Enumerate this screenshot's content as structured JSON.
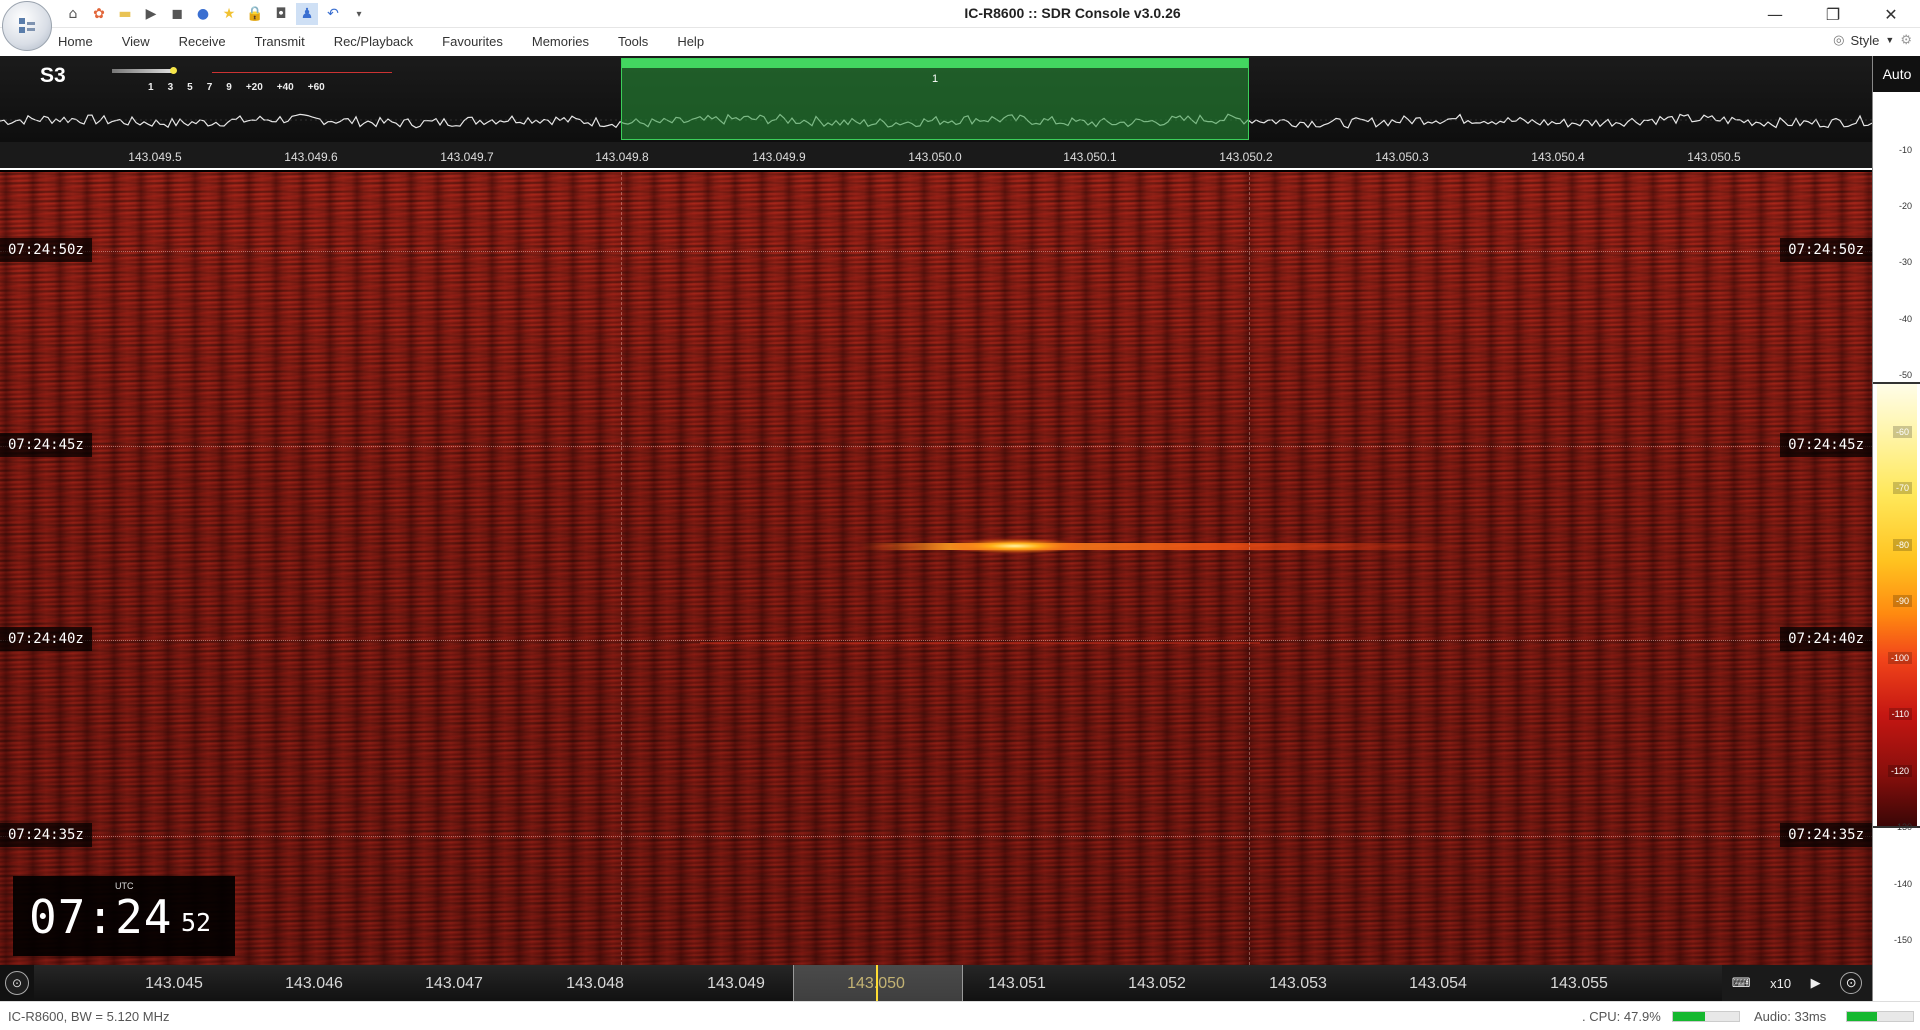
{
  "window": {
    "title": "IC-R8600 :: SDR Console v3.0.26"
  },
  "quick_access": [
    "home-icon",
    "radio-icon",
    "folder-icon",
    "play-icon",
    "stop-icon",
    "record-icon",
    "star-icon",
    "lock-icon",
    "camera-icon",
    "person-icon",
    "undo-icon",
    "dropdown-icon"
  ],
  "menu": [
    "Home",
    "View",
    "Receive",
    "Transmit",
    "Rec/Playback",
    "Favourites",
    "Memories",
    "Tools",
    "Help"
  ],
  "style_menu": {
    "label": "Style"
  },
  "spectrum": {
    "smeter": "S3",
    "smeter_scale": [
      "1",
      "3",
      "5",
      "7",
      "9",
      "+20",
      "+40",
      "+60"
    ],
    "filter_number": "1",
    "auto_label": "Auto"
  },
  "top_freq_axis": [
    "143.049.5",
    "143.049.6",
    "143.049.7",
    "143.049.8",
    "143.049.9",
    "143.050.0",
    "143.050.1",
    "143.050.2",
    "143.050.3",
    "143.050.4",
    "143.050.5"
  ],
  "waterfall": {
    "time_labels": [
      "07:24:50z",
      "07:24:45z",
      "07:24:40z",
      "07:24:35z"
    ]
  },
  "clock": {
    "utc_label": "UTC",
    "hours_minutes": "07:24",
    "seconds": "52"
  },
  "db_scale": {
    "auto_label": "Auto",
    "ticks": [
      "-10",
      "-20",
      "-30",
      "-40",
      "-50",
      "-60",
      "-70",
      "-80",
      "-90",
      "-100",
      "-110",
      "-120",
      "-130",
      "-140",
      "-150"
    ]
  },
  "bottom_freq_axis": [
    "143.045",
    "143.046",
    "143.047",
    "143.048",
    "143.049",
    "143.050",
    "143.051",
    "143.052",
    "143.053",
    "143.054",
    "143.055"
  ],
  "bottom_controls": {
    "zoom": "x10"
  },
  "status": {
    "device": "IC-R8600, BW = 5.120 MHz",
    "cpu": ". CPU: 47.9%",
    "cpu_level": 0.479,
    "audio": "Audio: 33ms",
    "audio_level": 0.45
  }
}
